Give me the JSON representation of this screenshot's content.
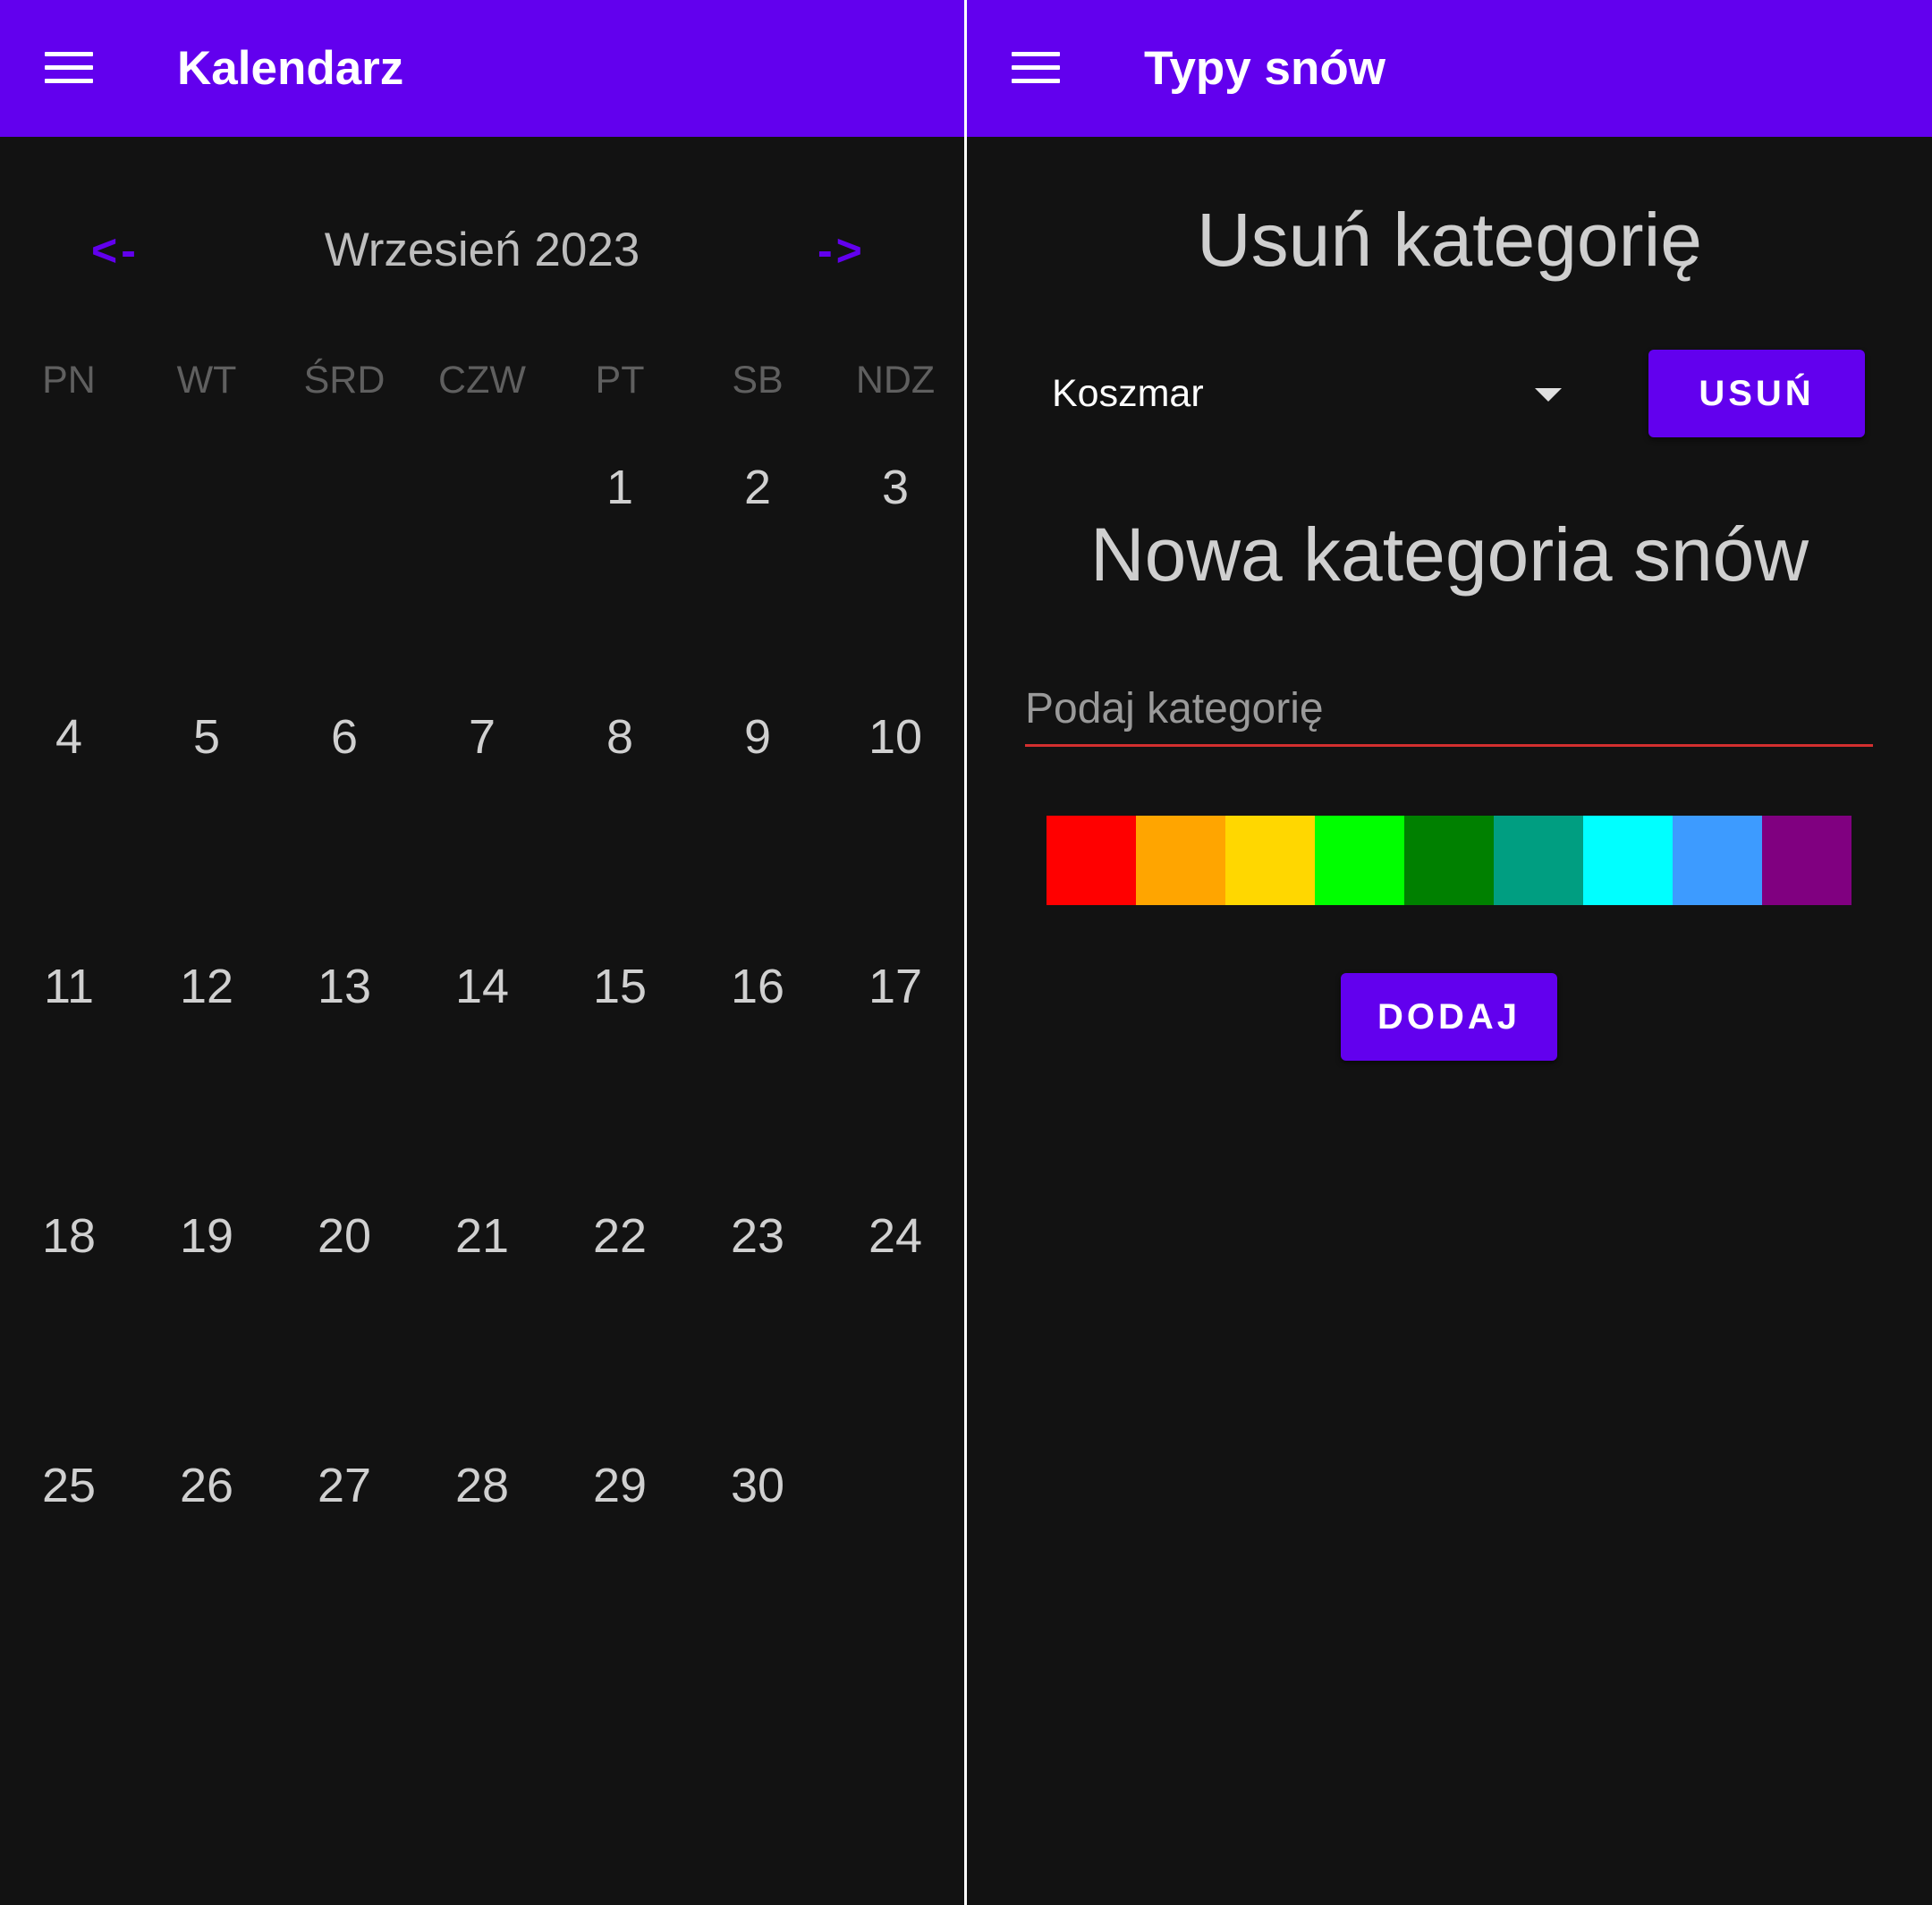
{
  "calendar_screen": {
    "title": "Kalendarz",
    "prev_label": "<-",
    "next_label": "->",
    "month_label": "Wrzesień 2023",
    "weekdays": [
      "PN",
      "WT",
      "ŚRD",
      "CZW",
      "PT",
      "SB",
      "NDZ"
    ],
    "leading_blank_days": 4,
    "days": [
      "1",
      "2",
      "3",
      "4",
      "5",
      "6",
      "7",
      "8",
      "9",
      "10",
      "11",
      "12",
      "13",
      "14",
      "15",
      "16",
      "17",
      "18",
      "19",
      "20",
      "21",
      "22",
      "23",
      "24",
      "25",
      "26",
      "27",
      "28",
      "29",
      "30"
    ]
  },
  "categories_screen": {
    "title": "Typy snów",
    "delete_heading": "Usuń kategorię",
    "selected_category": "Koszmar",
    "delete_button": "USUŃ",
    "new_heading": "Nowa kategoria snów",
    "input_placeholder": "Podaj kategorię",
    "input_value": "",
    "colors": [
      "#ff0000",
      "#ffa500",
      "#ffd700",
      "#00ff00",
      "#008000",
      "#009e81",
      "#00ffff",
      "#3d9bff",
      "#800080"
    ],
    "add_button": "DODAJ"
  },
  "theme": {
    "primary": "#6200ee",
    "background": "#121212",
    "error_underline": "#d32f2f"
  }
}
